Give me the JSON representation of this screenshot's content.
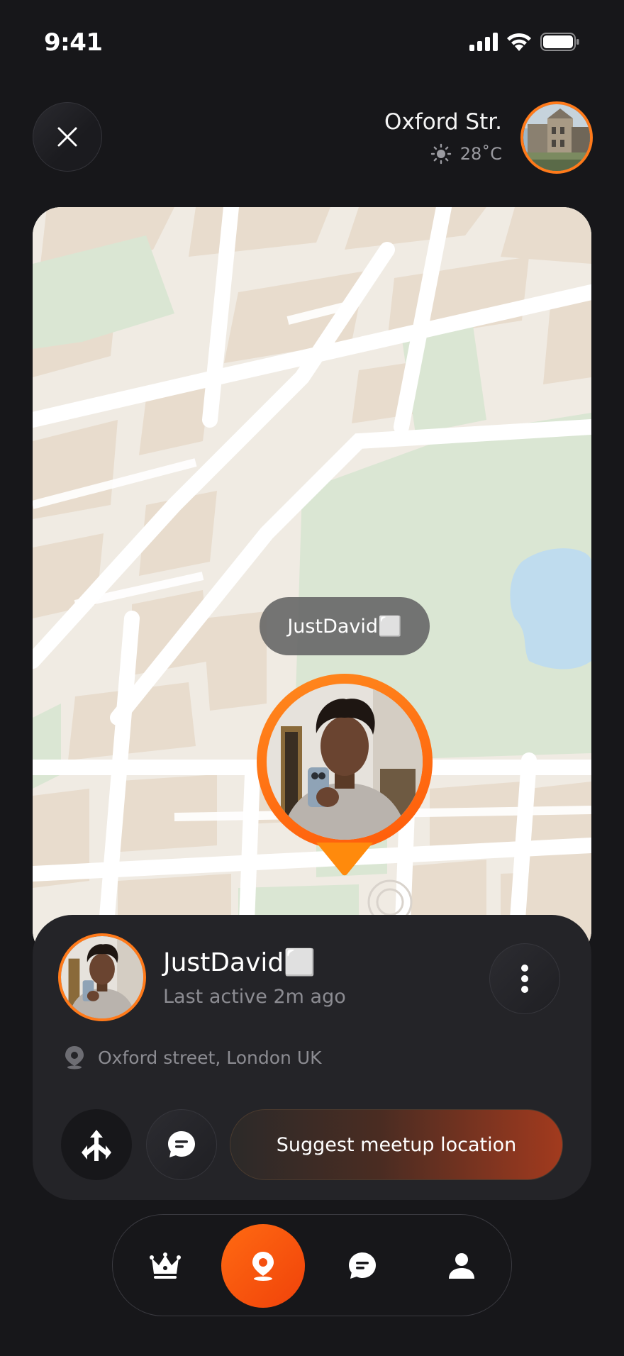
{
  "status_bar": {
    "time": "9:41"
  },
  "header": {
    "location_title": "Oxford Str.",
    "weather": {
      "icon": "sun-icon",
      "temperature": "28˚C"
    }
  },
  "map": {
    "marker_label": "JustDavid⬜"
  },
  "profile": {
    "name": "JustDavid⬜",
    "last_active": "Last active 2m ago",
    "address": "Oxford street, London UK"
  },
  "actions": {
    "directions_icon": "directions-icon",
    "chat_icon": "chat-icon",
    "suggest_label": "Suggest meetup location"
  },
  "nav": {
    "items": [
      {
        "icon": "crown-icon",
        "active": false
      },
      {
        "icon": "location-pin-icon",
        "active": true
      },
      {
        "icon": "chat-icon",
        "active": false
      },
      {
        "icon": "profile-icon",
        "active": false
      }
    ]
  },
  "colors": {
    "background": "#17171a",
    "accent": "#ff6a12",
    "sheet": "#242428",
    "map_park": "#d9e8d4",
    "map_water": "#bcdcef"
  }
}
